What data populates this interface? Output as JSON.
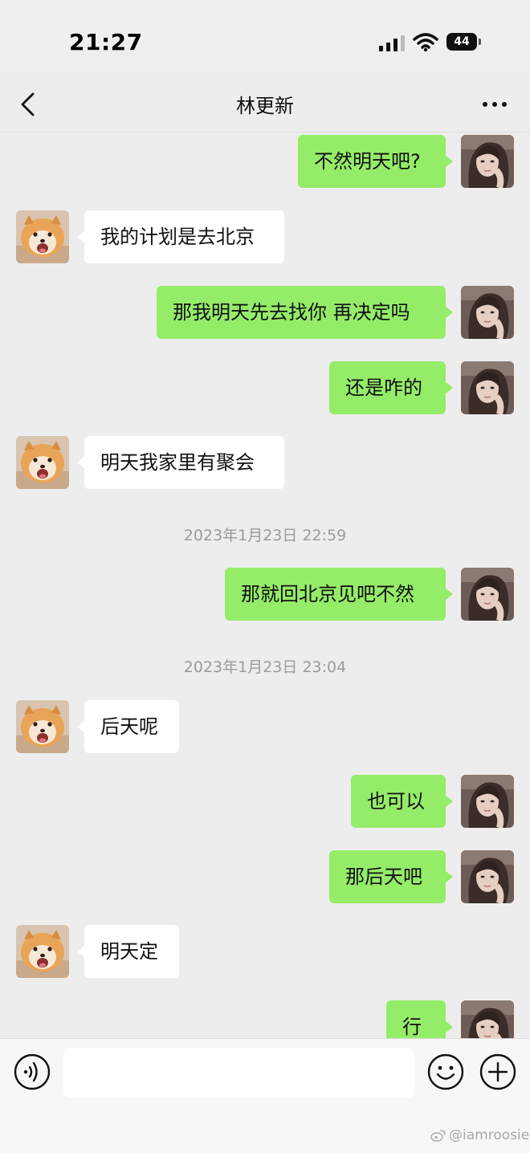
{
  "status_bar": {
    "time": "21:27",
    "battery": "44"
  },
  "header": {
    "title": "林更新",
    "back_icon": "chevron-left-icon",
    "more_icon": "more-dots-icon"
  },
  "messages": [
    {
      "type": "message",
      "side": "out",
      "text": "不然明天吧?"
    },
    {
      "type": "message",
      "side": "in",
      "text": "我的计划是去北京"
    },
    {
      "type": "message",
      "side": "out",
      "text": "那我明天先去找你 再决定吗"
    },
    {
      "type": "message",
      "side": "out",
      "text": "还是咋的"
    },
    {
      "type": "message",
      "side": "in",
      "text": "明天我家里有聚会"
    },
    {
      "type": "timestamp",
      "text": "2023年1月23日 22:59"
    },
    {
      "type": "message",
      "side": "out",
      "text": "那就回北京见吧不然"
    },
    {
      "type": "timestamp",
      "text": "2023年1月23日 23:04"
    },
    {
      "type": "message",
      "side": "in",
      "text": "后天呢"
    },
    {
      "type": "message",
      "side": "out",
      "text": "也可以"
    },
    {
      "type": "message",
      "side": "out",
      "text": "那后天吧"
    },
    {
      "type": "message",
      "side": "in",
      "text": "明天定"
    },
    {
      "type": "message",
      "side": "out",
      "text": "行"
    }
  ],
  "input_bar": {
    "voice_icon": "voice-icon",
    "text_value": "",
    "emoji_icon": "emoji-icon",
    "plus_icon": "plus-icon"
  },
  "watermark": "@iamroosie",
  "colors": {
    "outgoing_bubble": "#95ec69",
    "incoming_bubble": "#ffffff",
    "background": "#ededed"
  }
}
